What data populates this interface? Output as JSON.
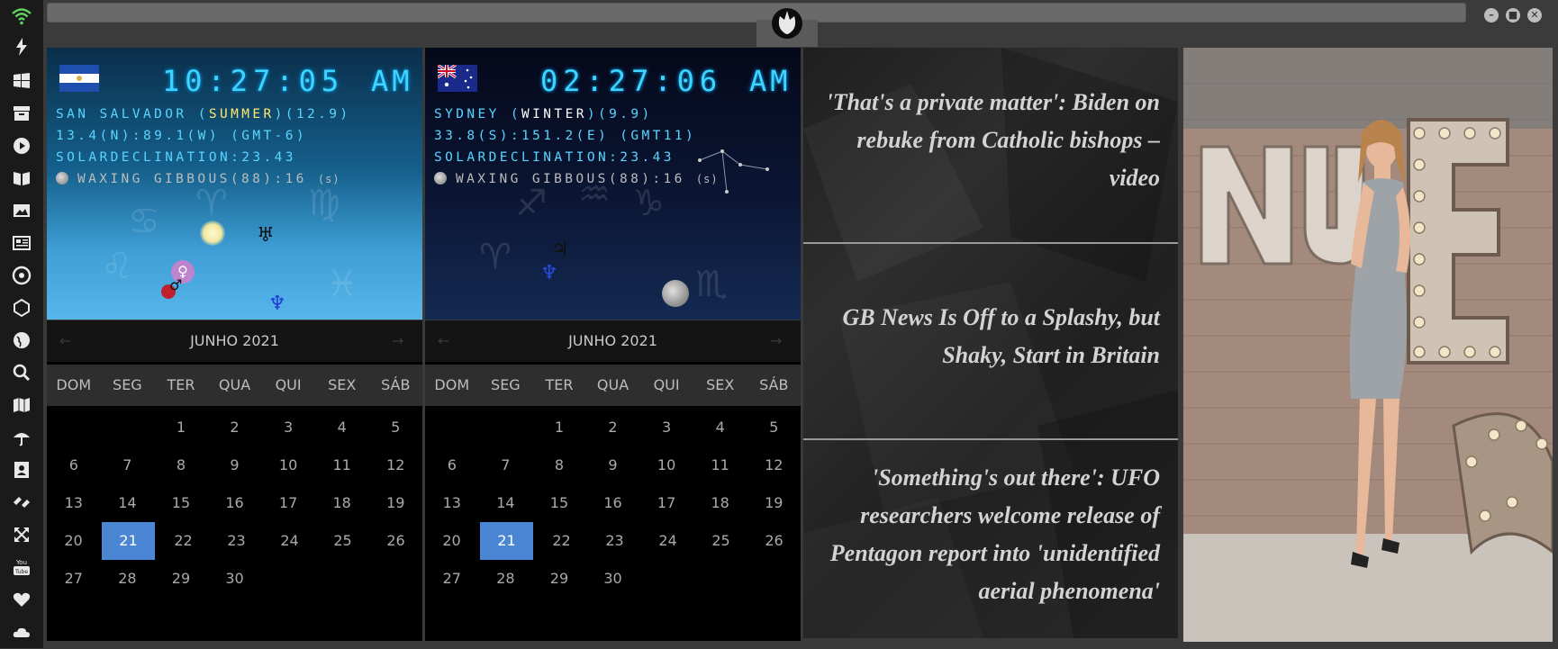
{
  "sidebar": {
    "icons": [
      "wifi-icon",
      "bolt-icon",
      "windows-icon",
      "archive-icon",
      "play-icon",
      "book-icon",
      "image-icon",
      "newspaper-icon",
      "settings-icon",
      "hexagon-icon",
      "globe-icon",
      "search-icon",
      "map-icon",
      "umbrella-icon",
      "contact-icon",
      "link-icon",
      "expand-icon",
      "youtube-icon",
      "heart-icon",
      "cloud-icon"
    ]
  },
  "clock1": {
    "time": "10:27:05",
    "ampm": "AM",
    "city": "SAN SALVADOR",
    "season": "SUMMER",
    "temp": "(12.9)",
    "line2": "13.4(N):89.1(W) (GMT-6)",
    "line3": "SOLARDECLINATION:23.43",
    "moon": "WAXING GIBBOUS(88):16",
    "moon_suffix": "(s)"
  },
  "clock2": {
    "time": "02:27:06",
    "ampm": "AM",
    "city": "SYDNEY",
    "season": "WINTER",
    "temp": "(9.9)",
    "line2": "33.8(S):151.2(E) (GMT11)",
    "line3": "SOLARDECLINATION:23.43",
    "moon": "WAXING GIBBOUS(88):16",
    "moon_suffix": "(s)"
  },
  "calendar": {
    "month_label": "JUNHO 2021",
    "days_of_week": [
      "DOM",
      "SEG",
      "TER",
      "QUA",
      "QUI",
      "SEX",
      "SÁB"
    ],
    "weeks": [
      [
        "",
        "",
        "1",
        "2",
        "3",
        "4",
        "5"
      ],
      [
        "6",
        "7",
        "8",
        "9",
        "10",
        "11",
        "12"
      ],
      [
        "13",
        "14",
        "15",
        "16",
        "17",
        "18",
        "19"
      ],
      [
        "20",
        "21",
        "22",
        "23",
        "24",
        "25",
        "26"
      ],
      [
        "27",
        "28",
        "29",
        "30",
        "",
        "",
        ""
      ]
    ],
    "selected_day": "21"
  },
  "news": {
    "items": [
      "'That's a private matter': Biden on rebuke from Catholic bishops – video",
      "GB News Is Off to a Splashy, but Shaky, Start in Britain",
      "'Something's out there': UFO researchers welcome release of Pentagon report into 'unidentified aerial phenomena'"
    ]
  },
  "colors": {
    "accent": "#4a86d4",
    "clock_text": "#3fd4ff",
    "season_text": "#ffe86b"
  }
}
